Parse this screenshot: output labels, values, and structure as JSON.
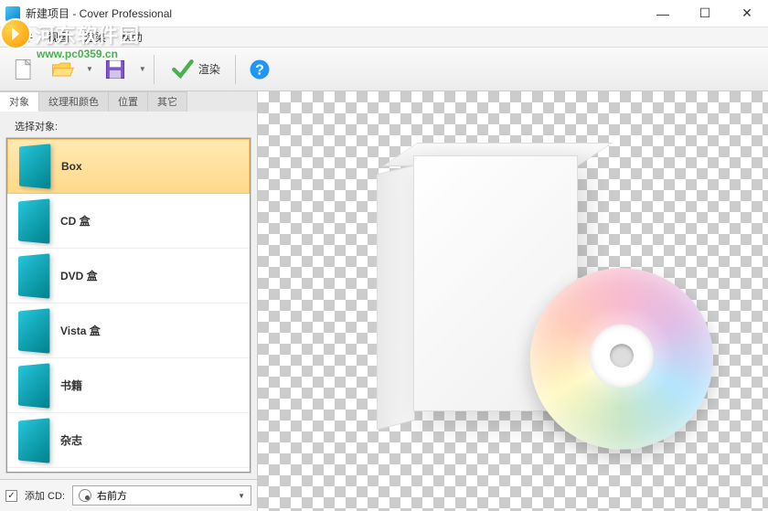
{
  "window": {
    "title": "新建项目 - Cover Professional"
  },
  "watermark": {
    "brand": "河东软件园",
    "url": "www.pc0359.cn"
  },
  "menu": {
    "items": [
      "文件",
      "视图",
      "渲染",
      "帮助"
    ]
  },
  "toolbar": {
    "render_label": "渲染"
  },
  "tabs": {
    "items": [
      "对象",
      "纹理和颜色",
      "位置",
      "其它"
    ],
    "active": 0
  },
  "panel": {
    "select_label": "选择对象:",
    "objects": [
      {
        "label": "Box",
        "selected": true
      },
      {
        "label": "CD 盒",
        "selected": false
      },
      {
        "label": "DVD 盒",
        "selected": false
      },
      {
        "label": "Vista 盒",
        "selected": false
      },
      {
        "label": "书籍",
        "selected": false
      },
      {
        "label": "杂志",
        "selected": false
      }
    ],
    "add_cd_label": "添加 CD:",
    "add_cd_checked": true,
    "cd_position": "右前方"
  }
}
